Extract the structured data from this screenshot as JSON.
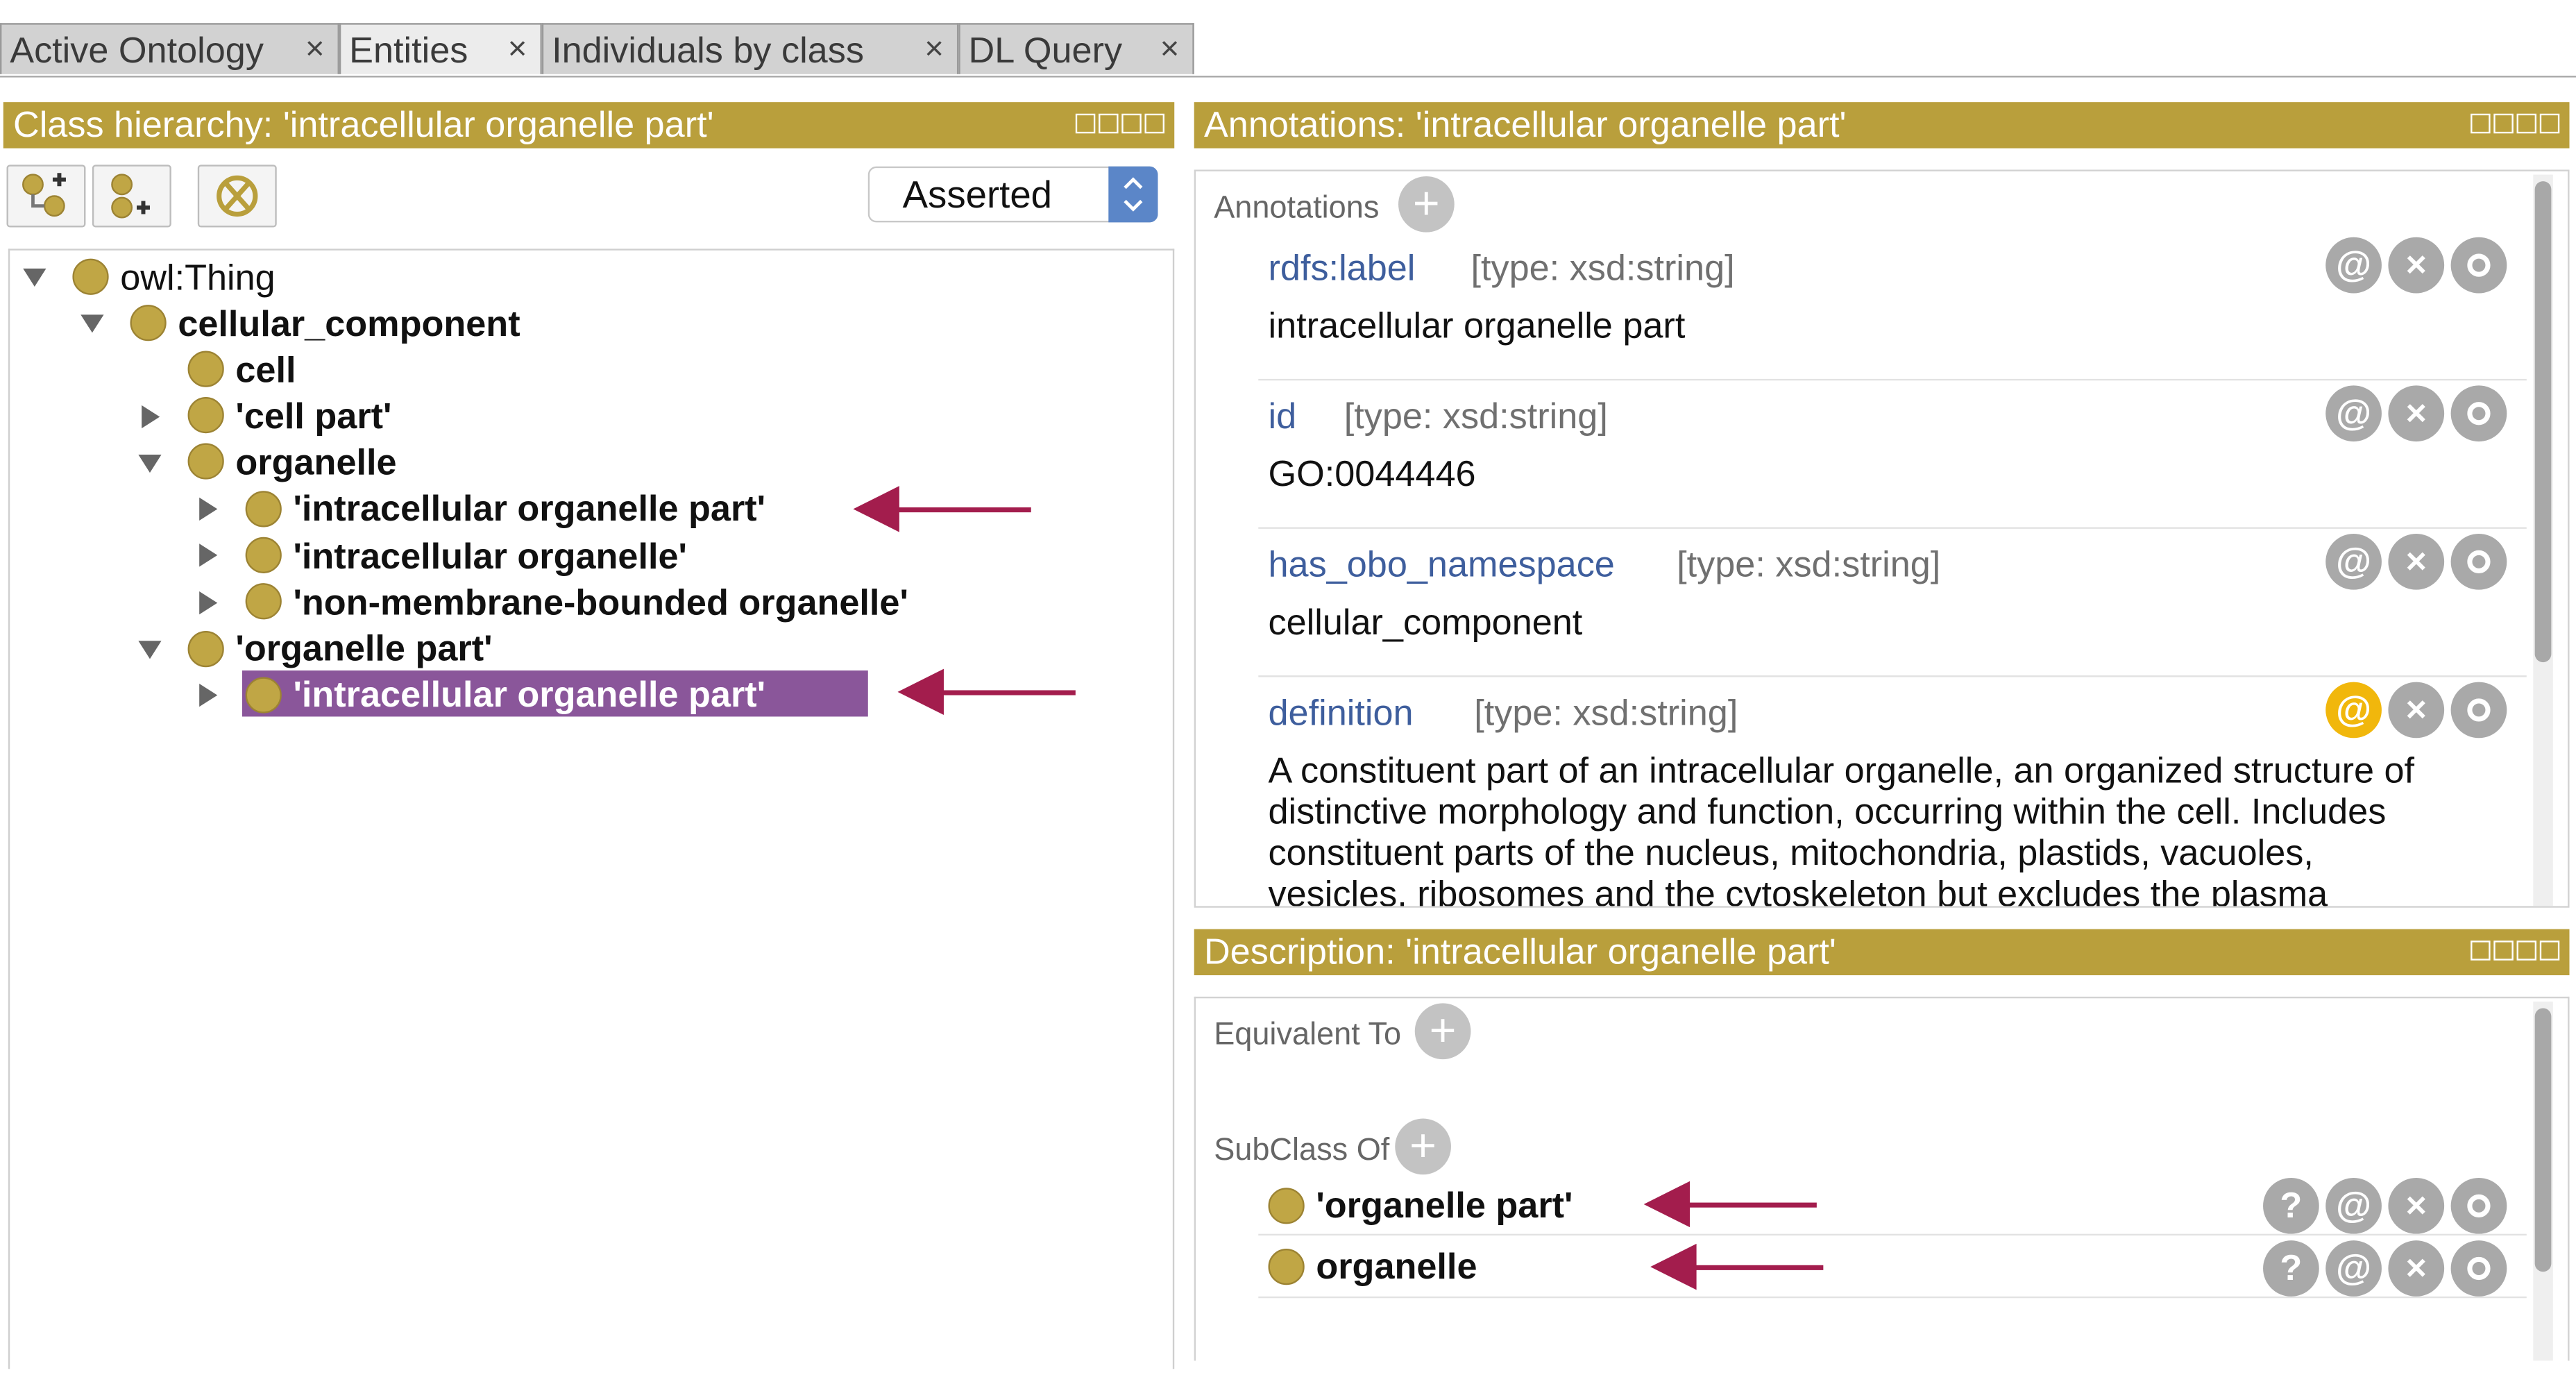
{
  "tabs": [
    {
      "label": "Active Ontology",
      "close": "×"
    },
    {
      "label": "Entities",
      "close": "×"
    },
    {
      "label": "Individuals by class",
      "close": "×"
    },
    {
      "label": "DL Query",
      "close": "×"
    }
  ],
  "class_panel": {
    "title": "Class hierarchy: 'intracellular organelle part'",
    "dropdown_value": "Asserted",
    "dropdown_arrows": "⌃⌄",
    "tree": [
      {
        "label": "owl:Thing"
      },
      {
        "label": "cellular_component"
      },
      {
        "label": "cell"
      },
      {
        "label": "'cell part'"
      },
      {
        "label": "organelle"
      },
      {
        "label": "'intracellular organelle part'"
      },
      {
        "label": "'intracellular organelle'"
      },
      {
        "label": "'non-membrane-bounded organelle'"
      },
      {
        "label": "'organelle part'"
      },
      {
        "label": "'intracellular organelle part'"
      }
    ]
  },
  "annotations_panel": {
    "title": "Annotations: 'intracellular organelle part'",
    "section_label": "Annotations",
    "plus": "+",
    "items": [
      {
        "property": "rdfs:label",
        "type": "[type: xsd:string]",
        "value": "intracellular organelle part"
      },
      {
        "property": "id",
        "type": "[type: xsd:string]",
        "value": "GO:0044446"
      },
      {
        "property": "has_obo_namespace",
        "type": "[type: xsd:string]",
        "value": "cellular_component"
      },
      {
        "property": "definition",
        "type": "[type: xsd:string]",
        "value_lines": [
          "A constituent part of an intracellular organelle, an organized structure of",
          "distinctive morphology and function, occurring within the cell. Includes",
          "constituent parts of the nucleus, mitochondria, plastids, vacuoles,",
          "vesicles, ribosomes and the cytoskeleton but excludes the plasma"
        ]
      }
    ],
    "btn_at": "@",
    "btn_x": "×"
  },
  "description_panel": {
    "title": "Description: 'intracellular organelle part'",
    "equivalent_label": "Equivalent To",
    "subclass_label": "SubClass Of",
    "plus": "+",
    "subclasses": [
      {
        "label": "'organelle part'"
      },
      {
        "label": "organelle"
      }
    ],
    "btn_q": "?",
    "btn_at": "@",
    "btn_x": "×"
  },
  "colors": {
    "panel_header": "#b99f3c",
    "class_ball": "#c0a645",
    "selection": "#8a569a",
    "arrow": "#a31d4d",
    "property_link": "#3e5e9d",
    "highlight_button": "#f1b70c"
  }
}
